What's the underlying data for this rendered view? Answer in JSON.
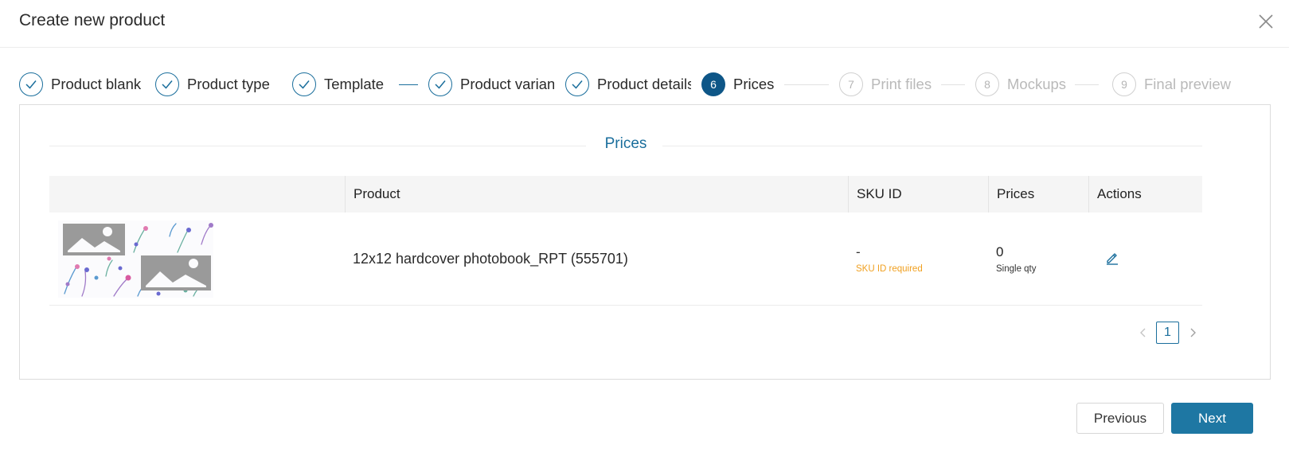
{
  "dialog": {
    "title": "Create new product",
    "close_icon": "close-icon"
  },
  "steps": [
    {
      "number": "1",
      "label": "Product blank",
      "status": "done"
    },
    {
      "number": "2",
      "label": "Product type",
      "status": "done"
    },
    {
      "number": "3",
      "label": "Template",
      "status": "done"
    },
    {
      "number": "4",
      "label": "Product variants",
      "status": "done"
    },
    {
      "number": "5",
      "label": "Product details",
      "status": "done"
    },
    {
      "number": "6",
      "label": "Prices",
      "status": "active"
    },
    {
      "number": "7",
      "label": "Print files",
      "status": "pending"
    },
    {
      "number": "8",
      "label": "Mockups",
      "status": "pending"
    },
    {
      "number": "9",
      "label": "Final preview",
      "status": "pending"
    }
  ],
  "section": {
    "title": "Prices"
  },
  "table": {
    "headers": [
      "",
      "Product",
      "SKU ID",
      "Prices",
      "Actions"
    ],
    "rows": [
      {
        "image_icon": "image-placeholder-icon",
        "product": "12x12 hardcover photobook_RPT (555701)",
        "sku_id": "-",
        "sku_hint": "SKU ID required",
        "price": "0",
        "price_hint": "Single qty",
        "action_icon": "pencil-edit-icon"
      }
    ]
  },
  "pagination": {
    "current_page": "1",
    "prev_icon": "chevron-left-icon",
    "next_icon": "chevron-right-icon"
  },
  "footer": {
    "previous_label": "Previous",
    "next_label": "Next"
  },
  "colors": {
    "accent": "#1a6e9c",
    "active_step": "#0e5687",
    "primary_button": "#1e77a3",
    "warning_text": "#f0a020",
    "pending": "#b9b9b9"
  }
}
